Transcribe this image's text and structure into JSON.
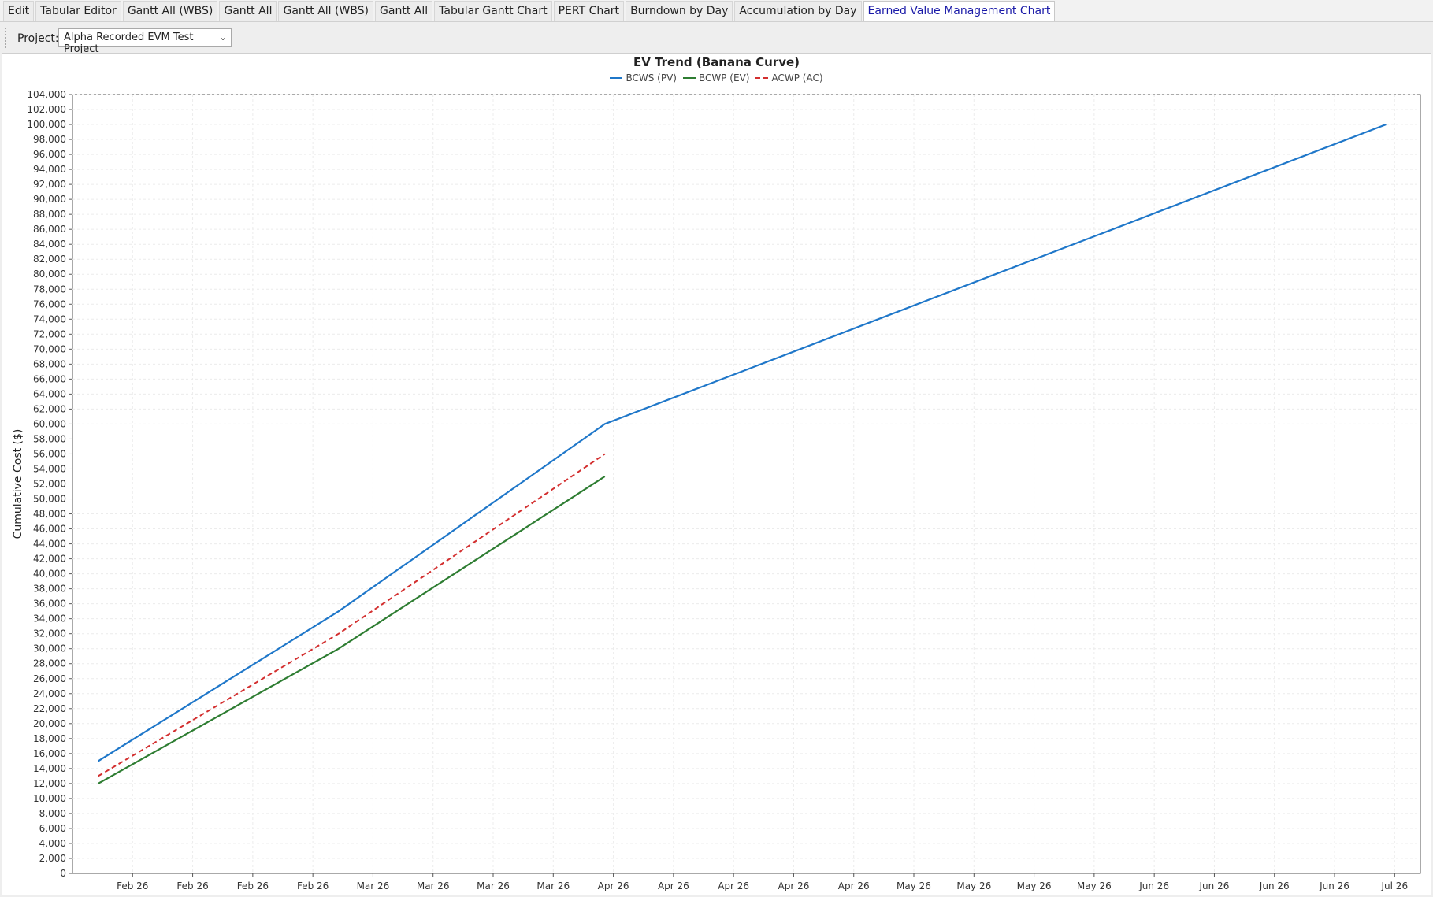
{
  "tabs": [
    {
      "label": "Edit",
      "active": false
    },
    {
      "label": "Tabular Editor",
      "active": false
    },
    {
      "label": "Gantt All (WBS)",
      "active": false
    },
    {
      "label": "Gantt All",
      "active": false
    },
    {
      "label": "Gantt All (WBS)",
      "active": false
    },
    {
      "label": "Gantt All",
      "active": false
    },
    {
      "label": "Tabular Gantt Chart",
      "active": false
    },
    {
      "label": "PERT Chart",
      "active": false
    },
    {
      "label": "Burndown by Day",
      "active": false
    },
    {
      "label": "Accumulation by Day",
      "active": false
    },
    {
      "label": "Earned Value Management Chart",
      "active": true
    }
  ],
  "toolbar": {
    "project_label": "Project:",
    "project_value": "Alpha Recorded EVM Test Project"
  },
  "chart_data": {
    "type": "line",
    "title": "EV Trend (Banana Curve)",
    "ylabel": "Cumulative Cost ($)",
    "xlabel": "",
    "ylim": [
      0,
      104000
    ],
    "y_tick_step": 2000,
    "grid": true,
    "legend_position": "top-center",
    "x_tick_labels": [
      "Feb 26",
      "Feb 26",
      "Feb 26",
      "Feb 26",
      "Mar 26",
      "Mar 26",
      "Mar 26",
      "Mar 26",
      "Apr 26",
      "Apr 26",
      "Apr 26",
      "Apr 26",
      "Apr 26",
      "May 26",
      "May 26",
      "May 26",
      "May 26",
      "Jun 26",
      "Jun 26",
      "Jun 26",
      "Jun 26",
      "Jul 26"
    ],
    "x_tick_days": [
      34,
      41,
      48,
      55,
      62,
      69,
      76,
      83,
      90,
      97,
      104,
      111,
      118,
      125,
      132,
      139,
      146,
      153,
      160,
      167,
      174,
      181
    ],
    "xlim_days": [
      27,
      184
    ],
    "series": [
      {
        "name": "BCWS (PV)",
        "color": "#1f77c9",
        "dash": false,
        "points": [
          {
            "day": 30,
            "value": 15000
          },
          {
            "day": 58,
            "value": 35000
          },
          {
            "day": 89,
            "value": 60000
          },
          {
            "day": 180,
            "value": 100000
          }
        ]
      },
      {
        "name": "BCWP (EV)",
        "color": "#2e7d32",
        "dash": false,
        "points": [
          {
            "day": 30,
            "value": 12000
          },
          {
            "day": 58,
            "value": 30000
          },
          {
            "day": 89,
            "value": 53000
          }
        ]
      },
      {
        "name": "ACWP (AC)",
        "color": "#d32f2f",
        "dash": true,
        "points": [
          {
            "day": 30,
            "value": 13000
          },
          {
            "day": 58,
            "value": 32000
          },
          {
            "day": 89,
            "value": 56000
          }
        ]
      }
    ]
  }
}
